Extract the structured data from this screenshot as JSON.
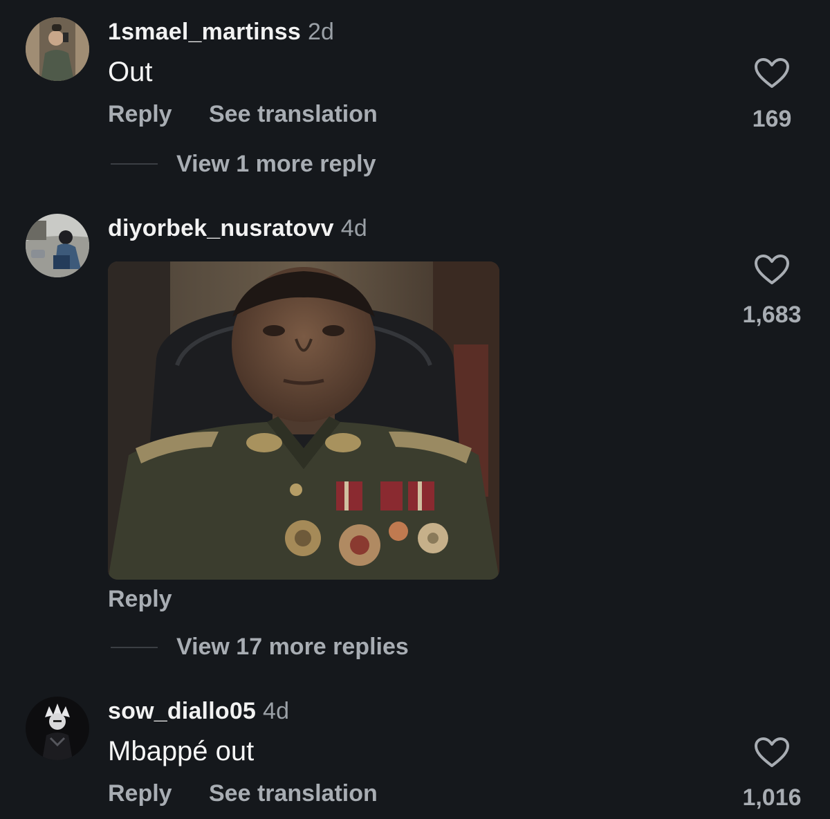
{
  "comments": [
    {
      "username": "1smael_martinss",
      "time": "2d",
      "text": "Out",
      "actions": {
        "reply": "Reply",
        "translate": "See translation"
      },
      "likes": "169",
      "view_replies": "View 1 more reply"
    },
    {
      "username": "diyorbek_nusratovv",
      "time": "4d",
      "actions": {
        "reply": "Reply"
      },
      "likes": "1,683",
      "view_replies": "View 17 more replies"
    },
    {
      "username": "sow_diallo05",
      "time": "4d",
      "text": "Mbappé out",
      "actions": {
        "reply": "Reply",
        "translate": "See translation"
      },
      "likes": "1,016"
    }
  ],
  "icons": {
    "like": "heart-outline-icon"
  },
  "colors": {
    "background": "#15181c",
    "secondary_text": "#a8adb3"
  }
}
